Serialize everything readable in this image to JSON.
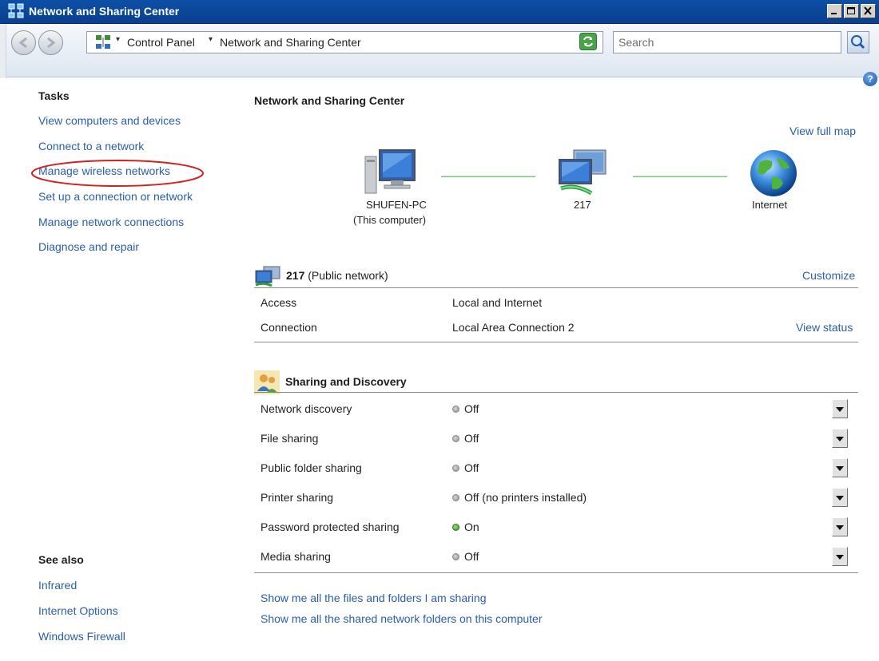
{
  "window": {
    "title": "Network and Sharing Center"
  },
  "address_bar": {
    "crumbs": [
      "Control Panel",
      "Network and Sharing Center"
    ],
    "search_placeholder": "Search"
  },
  "tasks": {
    "heading": "Tasks",
    "items": [
      "View computers and devices",
      "Connect to a network",
      "Manage wireless networks",
      "Set up a connection or network",
      "Manage network connections",
      "Diagnose and repair"
    ]
  },
  "see_also": {
    "heading": "See also",
    "items": [
      "Infrared",
      "Internet Options",
      "Windows Firewall"
    ]
  },
  "main": {
    "heading": "Network and Sharing Center",
    "view_full_map": "View full map",
    "map": {
      "computer_name": "SHUFEN-PC",
      "computer_sub": "(This computer)",
      "network_name": "217",
      "internet_label": "Internet"
    },
    "network": {
      "name": "217",
      "type": "(Public network)",
      "customize": "Customize",
      "rows": [
        {
          "label": "Access",
          "value": "Local and Internet",
          "action": ""
        },
        {
          "label": "Connection",
          "value": "Local Area Connection 2",
          "action": "View status"
        }
      ]
    },
    "sharing": {
      "heading": "Sharing and Discovery",
      "items": [
        {
          "label": "Network discovery",
          "state": "Off",
          "on": false
        },
        {
          "label": "File sharing",
          "state": "Off",
          "on": false
        },
        {
          "label": "Public folder sharing",
          "state": "Off",
          "on": false
        },
        {
          "label": "Printer sharing",
          "state": "Off (no printers installed)",
          "on": false
        },
        {
          "label": "Password protected sharing",
          "state": "On",
          "on": true
        },
        {
          "label": "Media sharing",
          "state": "Off",
          "on": false
        }
      ]
    },
    "bottom_links": [
      "Show me all the files and folders I am sharing",
      "Show me all the shared network folders on this computer"
    ]
  },
  "colors": {
    "link": "#2a5ea8",
    "titlebar": "#0c4fa6",
    "highlight_ellipse": "#d42020",
    "status_on": "#2b8d1a",
    "status_off": "#8a8a8a"
  },
  "icons": {
    "title": "network-center-icon",
    "back": "back-arrow-icon",
    "forward": "forward-arrow-icon",
    "address": "network-center-icon",
    "refresh": "refresh-icon",
    "search": "search-icon",
    "help": "help-icon",
    "computer": "computer-icon",
    "network": "network-icon",
    "internet": "globe-icon",
    "sharing": "sharing-people-icon",
    "expand": "chevron-down-icon"
  }
}
